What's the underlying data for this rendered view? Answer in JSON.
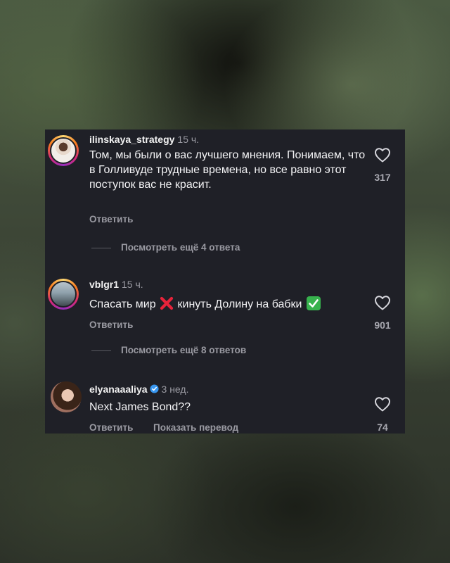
{
  "comments": [
    {
      "username": "ilinskaya_strategy",
      "time": "15 ч.",
      "text": "Том, мы были о вас лучшего мнения. Понимаем, что в Голливуде трудные времена, но все равно этот поступок вас не красит.",
      "reply_label": "Ответить",
      "likes": "317",
      "more_replies": "Посмотреть ещё 4 ответа",
      "avatar_icon": "profile-photo"
    },
    {
      "username": "vblgr1",
      "time": "15 ч.",
      "text_before": "Спасать мир",
      "text_middle": "кинуть Долину на бабки",
      "emoji_1": "❌",
      "emoji_2": "✅",
      "reply_label": "Ответить",
      "likes": "901",
      "more_replies": "Посмотреть ещё 8 ответов",
      "avatar_icon": "profile-photo"
    },
    {
      "username": "elyanaaaliya",
      "verified": true,
      "time": "3 нед.",
      "text": "Next James Bond??",
      "reply_label": "Ответить",
      "translate_label": "Показать перевод",
      "likes": "74",
      "avatar_icon": "profile-photo"
    }
  ],
  "colors": {
    "panel": "#1f2027",
    "text": "#f4f4f6",
    "muted": "#9a9aa2",
    "verified": "#3897f0"
  }
}
